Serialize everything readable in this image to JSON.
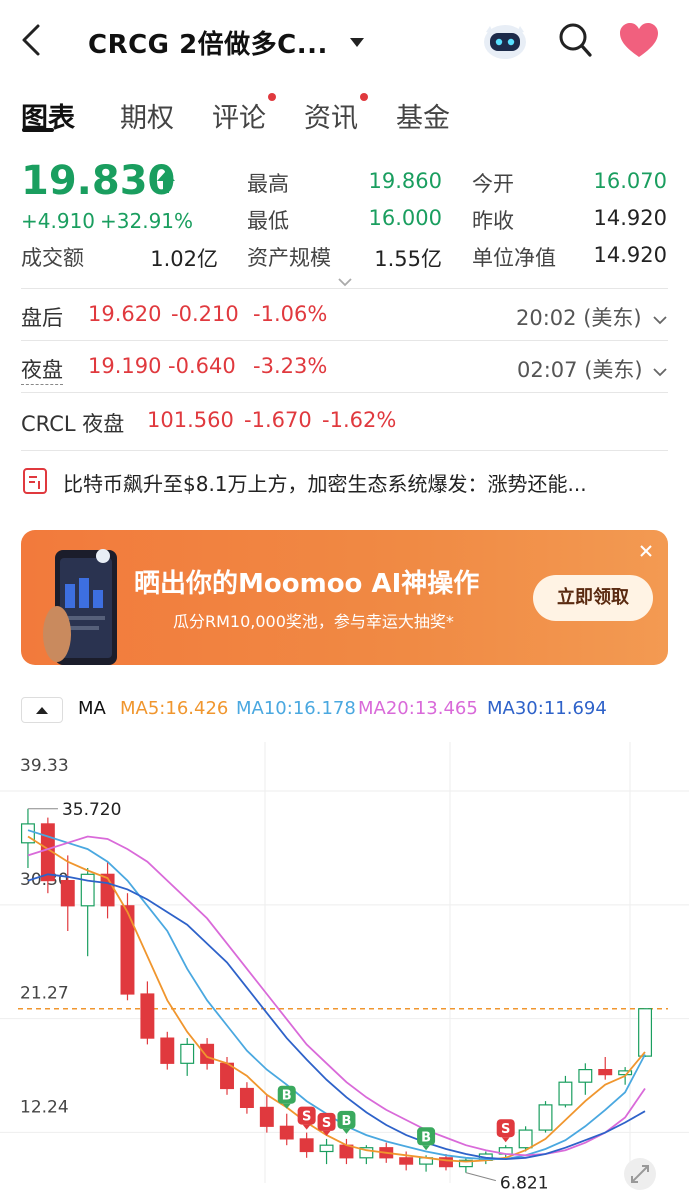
{
  "header": {
    "title": "CRCG  2倍做多C...",
    "dropdown_icon": "caret-down-icon"
  },
  "tabs": [
    {
      "label": "图表",
      "active": true,
      "dot": false
    },
    {
      "label": "期权",
      "active": false,
      "dot": false
    },
    {
      "label": "评论",
      "active": false,
      "dot": true
    },
    {
      "label": "资讯",
      "active": false,
      "dot": true
    },
    {
      "label": "基金",
      "active": false,
      "dot": false
    }
  ],
  "quote": {
    "price": "19.830",
    "change": "+4.910",
    "change_pct": "+32.91%",
    "turnover_label": "成交额",
    "turnover": "1.02亿",
    "stats": {
      "high_label": "最高",
      "high": "19.860",
      "low_label": "最低",
      "low": "16.000",
      "aum_label": "资产规模",
      "aum": "1.55亿",
      "open_label": "今开",
      "open": "16.070",
      "prev_close_label": "昨收",
      "prev_close": "14.920",
      "nav_label": "单位净值",
      "nav": "14.920"
    }
  },
  "after_hours": {
    "label": "盘后",
    "price": "19.620",
    "change": "-0.210",
    "pct": "-1.06%",
    "time": "20:02 (美东)"
  },
  "overnight": {
    "label": "夜盘",
    "price": "19.190",
    "change": "-0.640",
    "pct": "-3.23%",
    "time": "02:07 (美东)"
  },
  "underlying": {
    "label": "CRCL 夜盘",
    "price": "101.560",
    "change": "-1.670",
    "pct": "-1.62%"
  },
  "news": {
    "text": "比特币飙升至$8.1万上方，加密生态系统爆发：涨势还能..."
  },
  "banner": {
    "title": "晒出你的Moomoo AI神操作",
    "subtitle": "瓜分RM10,000奖池，参与幸运大抽奖*",
    "cta": "立即领取"
  },
  "chart_legend": {
    "ma": "MA",
    "ma5": "MA5:16.426",
    "ma10": "MA10:16.178",
    "ma20": "MA20:13.465",
    "ma30": "MA30:11.694"
  },
  "colors": {
    "up": "#1a9e5f",
    "down": "#e0393e",
    "ma5": "#f0962e",
    "ma10": "#4aa8e0",
    "ma20": "#d96ad9",
    "ma30": "#2e62c9"
  },
  "chart_data": {
    "type": "candlestick",
    "y_ticks": [
      "39.33",
      "30.30",
      "21.27",
      "12.24"
    ],
    "y_tick_values": [
      39.33,
      30.3,
      21.27,
      12.24
    ],
    "ylim": [
      6.0,
      41.0
    ],
    "high_marker": "35.720",
    "low_marker": "6.821",
    "current_line": 19.83,
    "grid": true,
    "candles": [
      [
        33.0,
        35.7,
        31.0,
        34.5
      ],
      [
        34.5,
        35.0,
        29.0,
        30.0
      ],
      [
        30.0,
        32.0,
        26.0,
        28.0
      ],
      [
        28.0,
        31.0,
        24.0,
        30.5
      ],
      [
        30.5,
        31.5,
        27.0,
        28.0
      ],
      [
        28.0,
        29.0,
        20.5,
        21.0
      ],
      [
        21.0,
        22.0,
        17.0,
        17.5
      ],
      [
        17.5,
        18.0,
        15.0,
        15.5
      ],
      [
        15.5,
        17.5,
        14.5,
        17.0
      ],
      [
        17.0,
        17.5,
        15.0,
        15.5
      ],
      [
        15.5,
        16.0,
        13.0,
        13.5
      ],
      [
        13.5,
        14.0,
        11.5,
        12.0
      ],
      [
        12.0,
        13.0,
        10.0,
        10.5
      ],
      [
        10.5,
        11.5,
        9.0,
        9.5
      ],
      [
        9.5,
        10.0,
        8.0,
        8.5
      ],
      [
        8.5,
        9.5,
        7.5,
        9.0
      ],
      [
        9.0,
        9.5,
        7.5,
        8.0
      ],
      [
        8.0,
        9.0,
        7.5,
        8.8
      ],
      [
        8.8,
        9.2,
        7.6,
        8.0
      ],
      [
        8.0,
        8.5,
        7.0,
        7.5
      ],
      [
        7.5,
        8.2,
        6.9,
        8.0
      ],
      [
        8.0,
        8.3,
        7.0,
        7.3
      ],
      [
        7.3,
        8.0,
        6.821,
        7.8
      ],
      [
        7.8,
        8.5,
        7.5,
        8.3
      ],
      [
        8.3,
        9.0,
        8.0,
        8.8
      ],
      [
        8.8,
        10.5,
        8.5,
        10.2
      ],
      [
        10.2,
        12.5,
        10.0,
        12.2
      ],
      [
        12.2,
        14.5,
        12.0,
        14.0
      ],
      [
        14.0,
        15.5,
        13.0,
        15.0
      ],
      [
        15.0,
        16.0,
        14.2,
        14.6
      ],
      [
        14.6,
        15.2,
        13.8,
        14.9
      ],
      [
        16.07,
        19.86,
        16.0,
        19.83
      ]
    ],
    "ma5": [
      33.5,
      32.5,
      31.5,
      30.8,
      30.2,
      27.5,
      24.0,
      20.5,
      18.0,
      16.0,
      15.5,
      14.5,
      13.0,
      12.0,
      10.8,
      9.8,
      9.0,
      8.6,
      8.4,
      8.2,
      8.0,
      7.8,
      7.7,
      7.8,
      8.0,
      8.6,
      9.5,
      11.0,
      12.5,
      13.8,
      14.5,
      16.4
    ],
    "ma10": [
      34.0,
      33.5,
      33.0,
      32.5,
      31.5,
      30.0,
      28.0,
      26.0,
      23.0,
      20.5,
      18.5,
      16.5,
      15.0,
      13.8,
      12.5,
      11.5,
      10.5,
      9.8,
      9.3,
      8.9,
      8.5,
      8.2,
      8.0,
      7.9,
      7.9,
      8.2,
      8.7,
      9.4,
      10.5,
      11.8,
      13.2,
      16.2
    ],
    "ma20": [
      32.0,
      32.5,
      33.0,
      33.5,
      33.3,
      32.5,
      31.5,
      30.0,
      28.5,
      27.0,
      25.0,
      23.0,
      21.0,
      19.0,
      17.0,
      15.5,
      14.0,
      12.8,
      11.8,
      11.0,
      10.2,
      9.6,
      9.0,
      8.6,
      8.3,
      8.2,
      8.3,
      8.6,
      9.2,
      10.0,
      11.2,
      13.5
    ],
    "ma30": [
      30.0,
      30.5,
      30.3,
      30.0,
      29.8,
      29.3,
      28.5,
      27.5,
      26.5,
      25.0,
      23.5,
      21.5,
      19.5,
      17.5,
      15.8,
      14.2,
      12.8,
      11.6,
      10.6,
      9.8,
      9.2,
      8.7,
      8.3,
      8.0,
      7.9,
      8.0,
      8.3,
      8.8,
      9.4,
      10.0,
      10.8,
      11.7
    ],
    "signals": [
      {
        "i": 13,
        "type": "B"
      },
      {
        "i": 14,
        "type": "S"
      },
      {
        "i": 15,
        "type": "S"
      },
      {
        "i": 16,
        "type": "B"
      },
      {
        "i": 20,
        "type": "B"
      },
      {
        "i": 24,
        "type": "S"
      }
    ]
  }
}
